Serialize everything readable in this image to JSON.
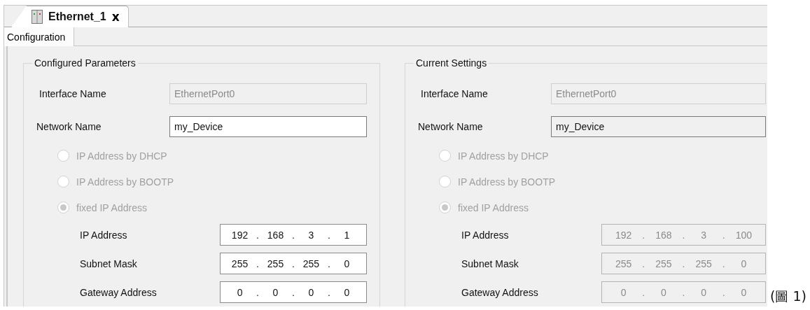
{
  "editor_tab": {
    "title": "Ethernet_1",
    "close": "x",
    "selected": true
  },
  "subtabs": [
    {
      "label": "Configuration",
      "selected": true
    }
  ],
  "panels": [
    {
      "title": "Configured Parameters",
      "interface_name": {
        "label": "Interface Name",
        "value": "EthernetPort0",
        "disabled": true
      },
      "network_name": {
        "label": "Network Name",
        "value": "my_Device",
        "disabled": false
      },
      "options": [
        {
          "label": "IP Address by DHCP",
          "selected": false,
          "disabled": true
        },
        {
          "label": "IP Address by BOOTP",
          "selected": false,
          "disabled": true
        },
        {
          "label": "fixed IP Address",
          "selected": true,
          "disabled": true
        }
      ],
      "addresses": [
        {
          "label": "IP Address",
          "octets": [
            "192",
            "168",
            "3",
            "1"
          ],
          "separators": [
            ".",
            ".",
            "."
          ],
          "disabled": false
        },
        {
          "label": "Subnet Mask",
          "octets": [
            "255",
            "255",
            "255",
            "0"
          ],
          "separators": [
            ".",
            ".",
            "."
          ],
          "disabled": false
        },
        {
          "label": "Gateway Address",
          "octets": [
            "0",
            "0",
            "0",
            "0"
          ],
          "separators": [
            ".",
            ".",
            "."
          ],
          "disabled": false
        }
      ]
    },
    {
      "title": "Current Settings",
      "interface_name": {
        "label": "Interface Name",
        "value": "EthernetPort0",
        "disabled": true
      },
      "network_name": {
        "label": "Network Name",
        "value": "my_Device",
        "disabled": true
      },
      "options": [
        {
          "label": "IP Address by DHCP",
          "selected": false,
          "disabled": true
        },
        {
          "label": "IP Address by BOOTP",
          "selected": false,
          "disabled": true
        },
        {
          "label": "fixed IP Address",
          "selected": true,
          "disabled": true
        }
      ],
      "addresses": [
        {
          "label": "IP Address",
          "octets": [
            "192",
            "168",
            "3",
            "100"
          ],
          "separators": [
            ".",
            ".",
            "."
          ],
          "disabled": true
        },
        {
          "label": "Subnet Mask",
          "octets": [
            "255",
            "255",
            "255",
            "0"
          ],
          "separators": [
            ".",
            ".",
            "."
          ],
          "disabled": true
        },
        {
          "label": "Gateway Address",
          "octets": [
            "0",
            "0",
            "0",
            "0"
          ],
          "separators": [
            ".",
            ".",
            "."
          ],
          "disabled": true
        }
      ]
    }
  ],
  "caption": "(圖 1)"
}
